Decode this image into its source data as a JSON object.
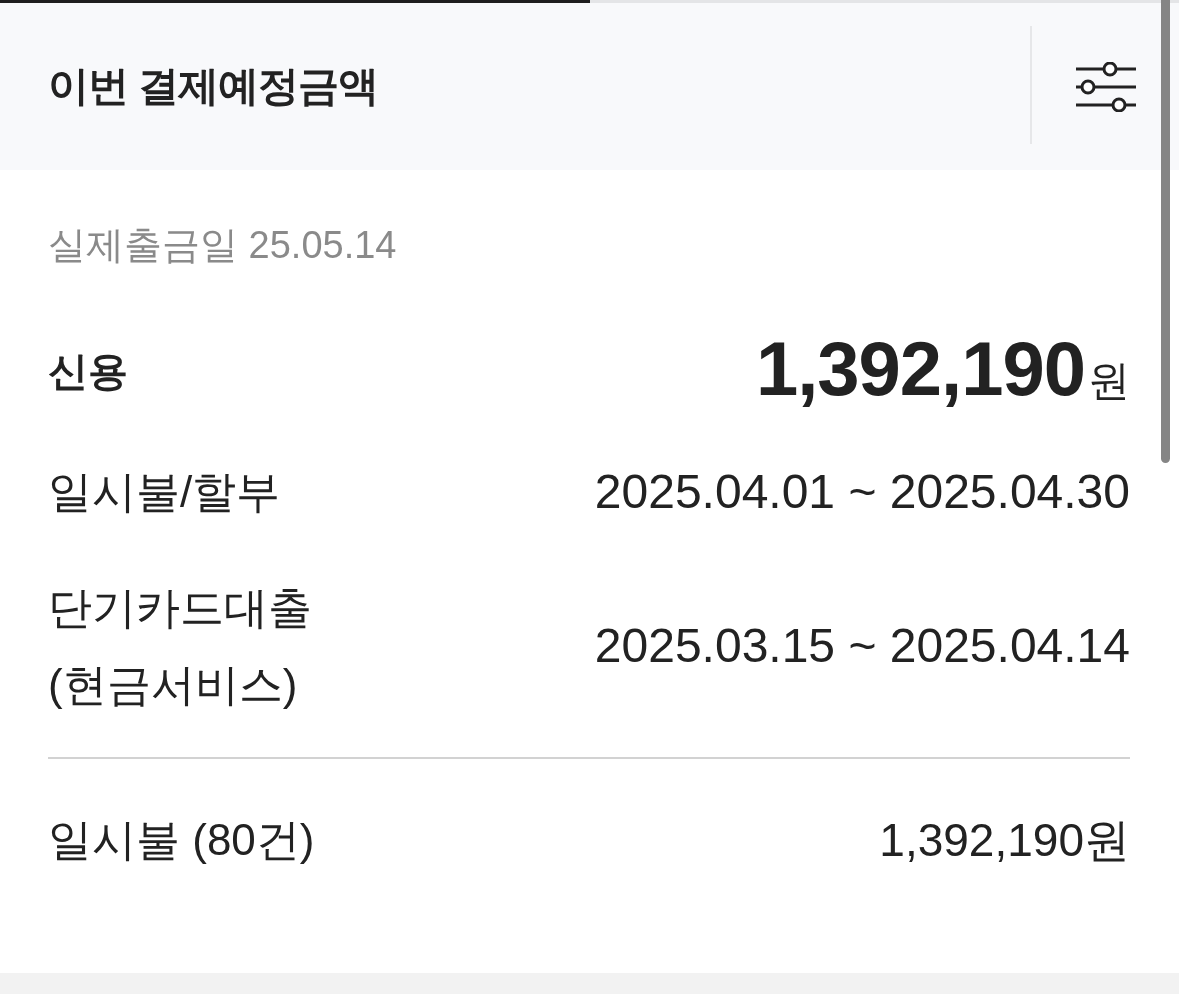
{
  "tabs": [
    {
      "selected": true
    },
    {
      "selected": false
    }
  ],
  "header": {
    "title": "이번 결제예정금액"
  },
  "withdrawal": {
    "text": "실제출금일 25.05.14"
  },
  "total": {
    "label": "신용",
    "amount": "1,392,190",
    "unit": "원"
  },
  "periods": [
    {
      "label_lines": [
        "일시불/할부"
      ],
      "range": "2025.04.01 ~ 2025.04.30"
    },
    {
      "label_lines": [
        "단기카드대출",
        "(현금서비스)"
      ],
      "range": "2025.03.15 ~ 2025.04.14"
    }
  ],
  "breakdown": [
    {
      "label": "일시불 (80건)",
      "amount": "1,392,190원"
    }
  ]
}
